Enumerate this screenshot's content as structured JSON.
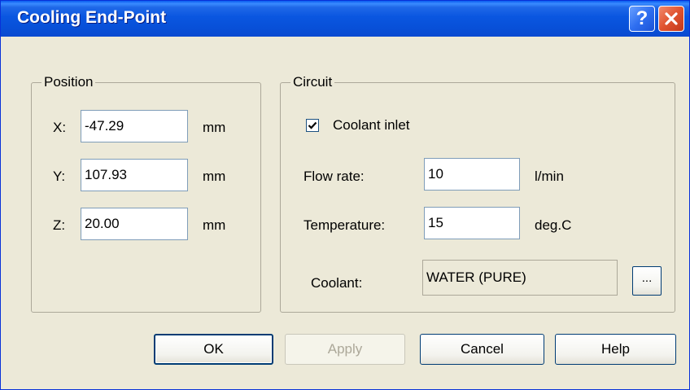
{
  "window": {
    "title": "Cooling End-Point",
    "help_glyph": "?"
  },
  "position": {
    "group_label": "Position",
    "x": {
      "label": "X:",
      "value": "-47.29",
      "unit": "mm"
    },
    "y": {
      "label": "Y:",
      "value": "107.93",
      "unit": "mm"
    },
    "z": {
      "label": "Z:",
      "value": "20.00",
      "unit": "mm"
    }
  },
  "circuit": {
    "group_label": "Circuit",
    "coolant_inlet": {
      "label": "Coolant inlet",
      "checked": true
    },
    "flow_rate": {
      "label": "Flow rate:",
      "value": "10",
      "unit": "l/min"
    },
    "temperature": {
      "label": "Temperature:",
      "value": "15",
      "unit": "deg.C"
    },
    "coolant": {
      "label": "Coolant:",
      "value": "WATER (PURE)",
      "browse_label": "..."
    }
  },
  "buttons": {
    "ok": "OK",
    "apply": "Apply",
    "cancel": "Cancel",
    "help": "Help"
  },
  "colors": {
    "title_bar": "#0a56e0",
    "dialog_bg": "#ece9d8",
    "close_button": "#e0532f",
    "input_border": "#7f9db9"
  },
  "icons": {
    "help": "question-mark-icon",
    "close": "close-x-icon",
    "check": "checkmark-icon"
  }
}
